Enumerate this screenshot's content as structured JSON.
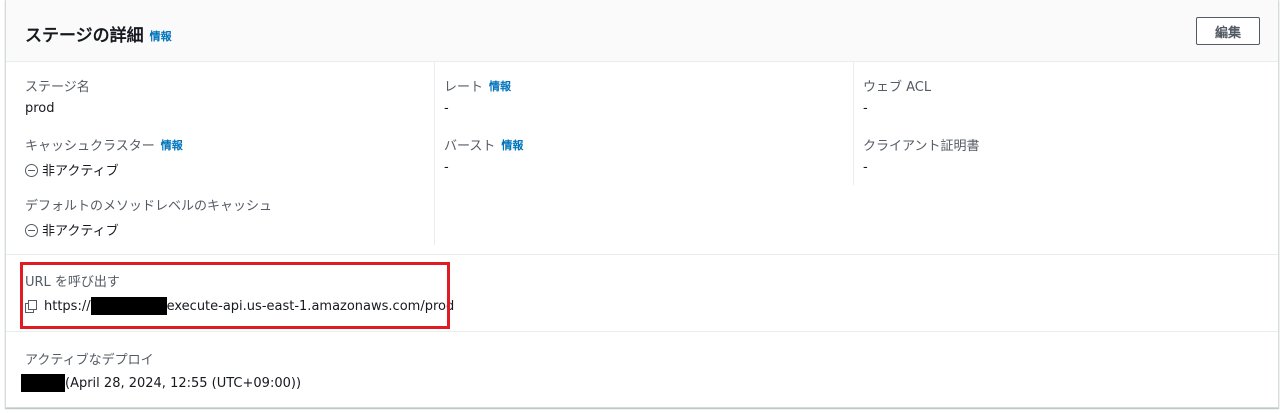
{
  "header": {
    "title": "ステージの詳細",
    "info_link": "情報",
    "edit_button": "編集"
  },
  "column1": {
    "stage_name_label": "ステージ名",
    "stage_name_value": "prod",
    "cache_cluster_label": "キャッシュクラスター",
    "cache_cluster_info": "情報",
    "cache_cluster_value": "非アクティブ",
    "default_method_cache_label": "デフォルトのメソッドレベルのキャッシュ",
    "default_method_cache_value": "非アクティブ"
  },
  "column2": {
    "rate_label": "レート",
    "rate_info": "情報",
    "rate_value": "-",
    "burst_label": "バースト",
    "burst_info": "情報",
    "burst_value": "-"
  },
  "column3": {
    "web_acl_label": "ウェブ ACL",
    "web_acl_value": "-",
    "client_cert_label": "クライアント証明書",
    "client_cert_value": "-"
  },
  "invoke_url": {
    "label": "URL を呼び出す",
    "prefix": "https://",
    "suffix": "execute-api.us-east-1.amazonaws.com/prod"
  },
  "active_deployment": {
    "label": "アクティブなデプロイ",
    "value": "(April 28, 2024, 12:55 (UTC+09:00))"
  },
  "colors": {
    "link": "#0073bb",
    "highlight": "#e01b24",
    "redaction": "#000000"
  }
}
